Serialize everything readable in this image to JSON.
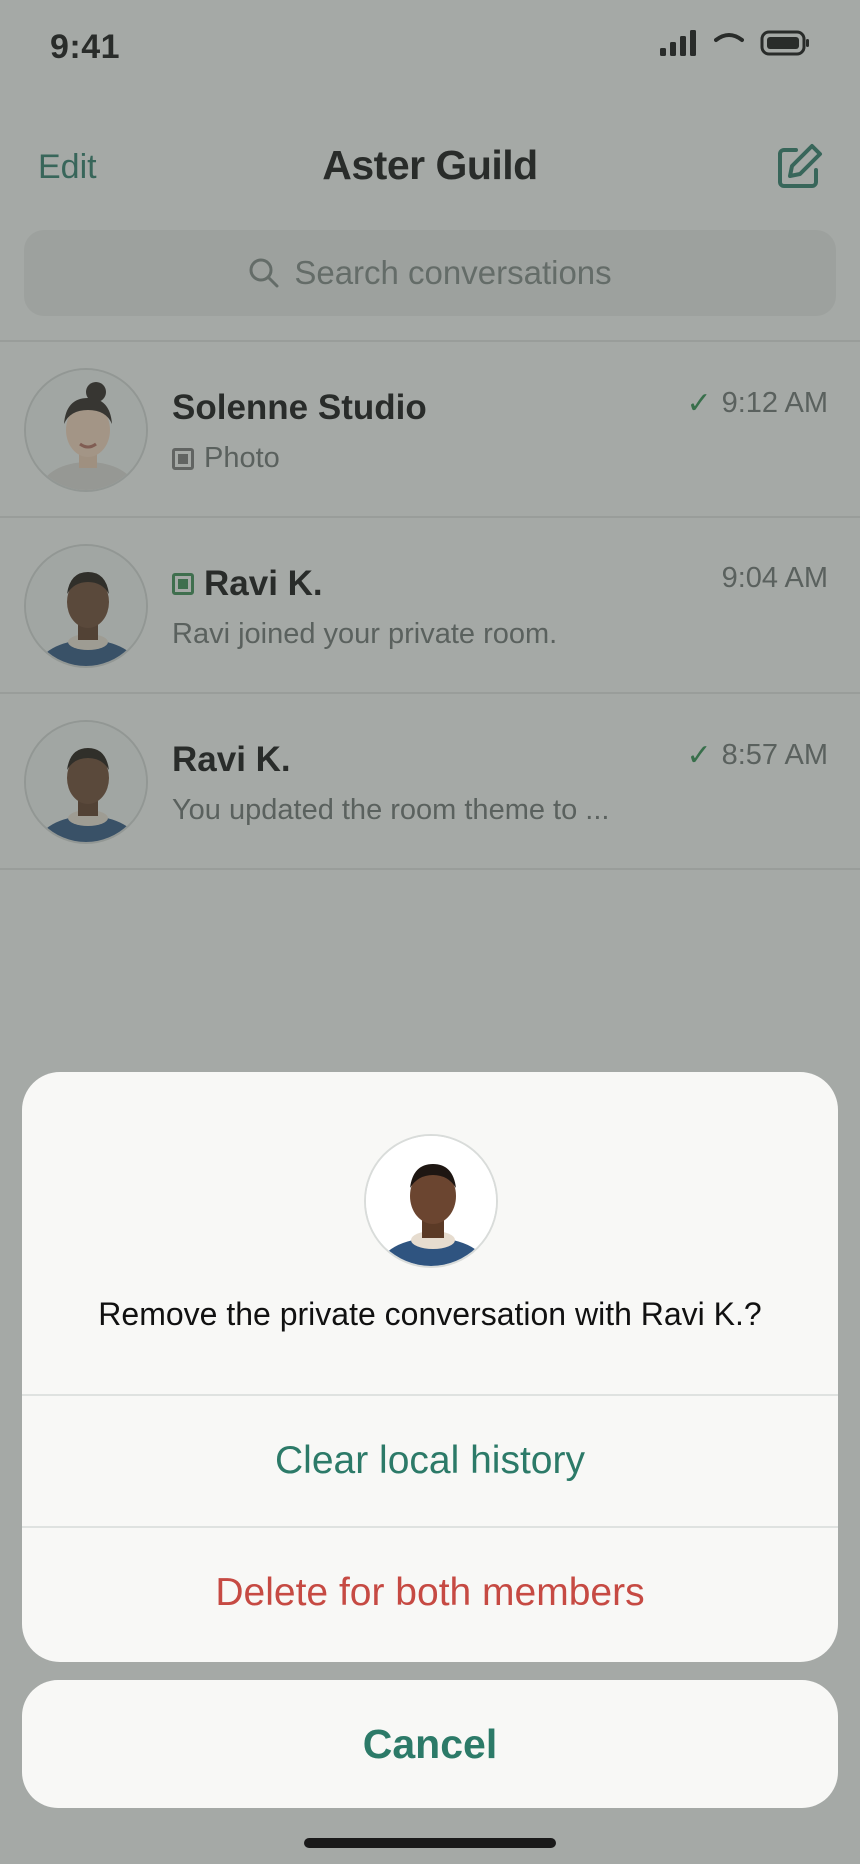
{
  "status": {
    "time": "9:41",
    "icons": [
      "signal-icon",
      "wifi-icon",
      "battery-icon"
    ]
  },
  "nav": {
    "edit": "Edit",
    "title": "Aster Guild",
    "compose_icon": "compose-icon"
  },
  "search": {
    "placeholder": "Search conversations"
  },
  "conversations": [
    {
      "name": "Solenne Studio",
      "preview": "Photo",
      "time": "9:12 AM",
      "read_check": true,
      "preview_icon": "photo-icon"
    },
    {
      "name": "Ravi K.",
      "preview": "Ravi joined your private room.",
      "time": "9:04 AM",
      "read_check": false,
      "name_icon": "private-room-icon"
    },
    {
      "name": "Ravi K.",
      "preview": "You updated the room theme to ...",
      "time": "8:57 AM",
      "read_check": true
    }
  ],
  "sheet": {
    "message": "Remove the private conversation with Ravi K.?",
    "clear_label": "Clear local history",
    "delete_label": "Delete for both members",
    "cancel_label": "Cancel"
  },
  "colors": {
    "accent": "#2c7a68",
    "destructive": "#c64a43",
    "check": "#2d8b4e"
  }
}
